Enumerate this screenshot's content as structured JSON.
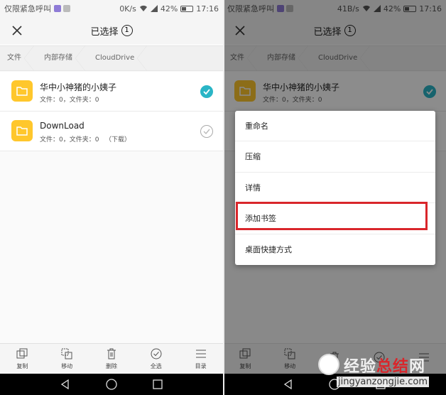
{
  "colors": {
    "accent": "#2ab5c6",
    "folder": "#ffc72c",
    "highlight": "#d9262b"
  },
  "left": {
    "status": {
      "carrier": "仅限紧急呼叫",
      "speed": "0K/s",
      "battery": "42%",
      "time": "17:16"
    },
    "title": "已选择",
    "count": "1",
    "crumbs": [
      "文件",
      "内部存储",
      "CloudDrive"
    ],
    "items": [
      {
        "name": "华中小神猪的小姨子",
        "meta": "文件：0，文件夹：0",
        "checked": true
      },
      {
        "name": "DownLoad",
        "meta": "文件：0，文件夹：0   （下载）",
        "checked": false
      }
    ],
    "toolbar": [
      "复制",
      "移动",
      "删除",
      "全选",
      "目录"
    ]
  },
  "right": {
    "status": {
      "carrier": "仅限紧急呼叫",
      "speed": "41B/s",
      "battery": "42%",
      "time": "17:16"
    },
    "title": "已选择",
    "count": "1",
    "crumbs": [
      "文件",
      "内部存储",
      "CloudDrive"
    ],
    "items": [
      {
        "name": "华中小神猪的小姨子",
        "meta": "文件：0，文件夹：0",
        "checked": true
      }
    ],
    "menu": [
      "重命名",
      "压缩",
      "详情",
      "添加书签",
      "桌面快捷方式"
    ],
    "toolbar": [
      "复制",
      "移动"
    ]
  },
  "watermark": {
    "brand_a": "经验",
    "brand_b": "总结",
    "brand_c": "网",
    "url": "jingyanzongjie.com"
  }
}
